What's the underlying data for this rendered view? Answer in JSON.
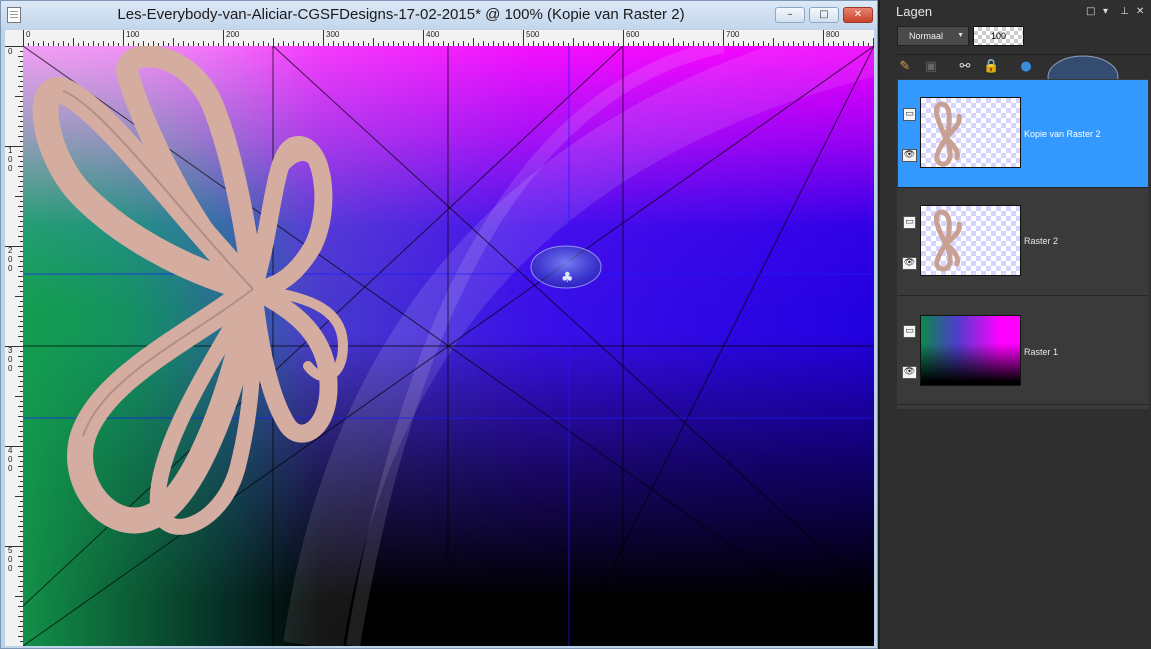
{
  "document": {
    "title": "Les-Everybody-van-Aliciar-CGSFDesigns-17-02-2015* @ 100% (Kopie van Raster 2)",
    "window_buttons": {
      "minimize": "–",
      "maximize": "□",
      "close": "✕"
    },
    "ruler_h_labels": [
      "0",
      "100",
      "200",
      "300",
      "400",
      "500",
      "600",
      "700",
      "800"
    ],
    "ruler_v_labels": [
      "0",
      "100",
      "200",
      "300",
      "400",
      "500"
    ]
  },
  "layers_panel": {
    "title": "Lagen",
    "title_buttons": {
      "restore": "□",
      "menu": "▾",
      "pin": "⊥",
      "close": "✕"
    },
    "blend_mode": "Normaal",
    "opacity": "100",
    "layers": [
      {
        "name": "Kopie van Raster 2",
        "selected": true,
        "visible": true
      },
      {
        "name": "Raster 2",
        "selected": false,
        "visible": true
      },
      {
        "name": "Raster 1",
        "selected": false,
        "visible": true
      }
    ],
    "toolbar_icons": [
      "edit-mask-icon",
      "layer-style-icon",
      "link-icon",
      "lock-icon",
      "layer-color-icon"
    ]
  },
  "colors": {
    "selected_layer": "#3399ff",
    "ribbon": "#d4ada0",
    "panel_bg": "#2f2f2f"
  }
}
